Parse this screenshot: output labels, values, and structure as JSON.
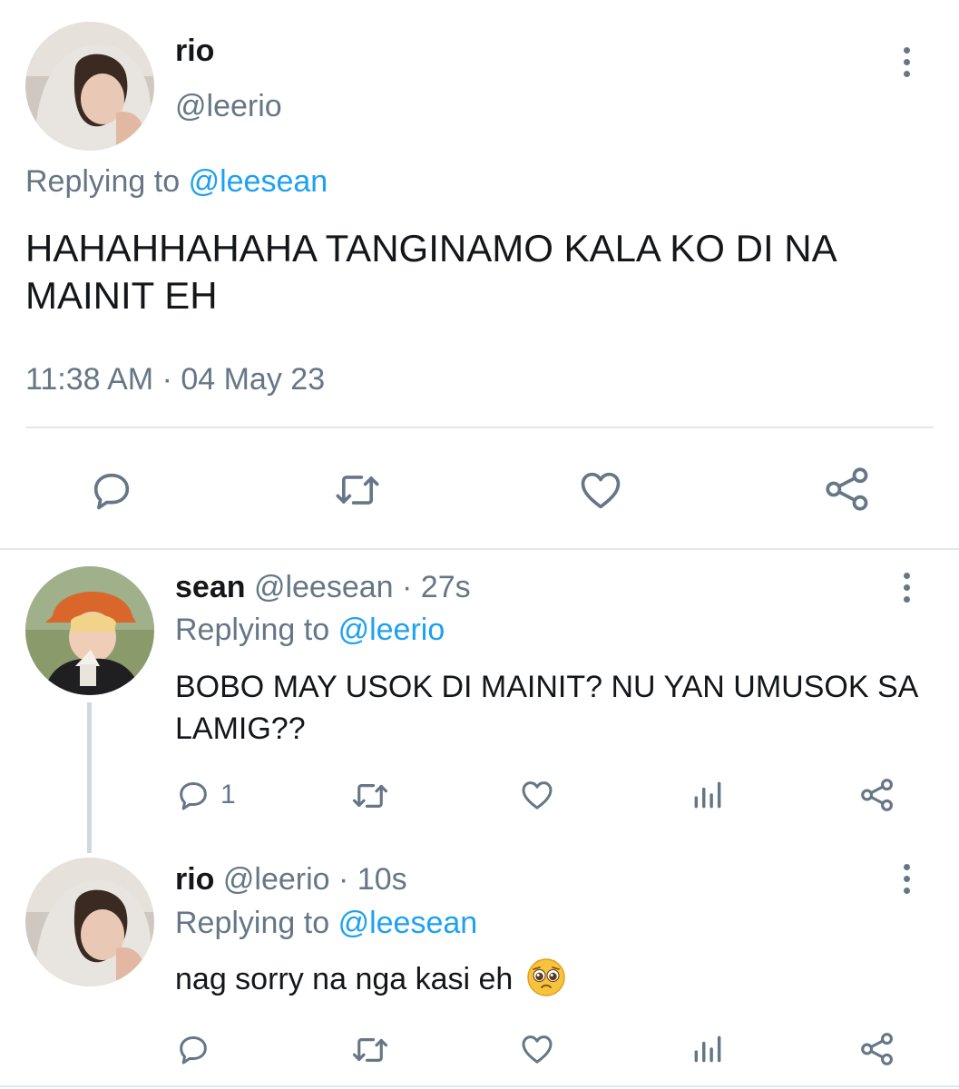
{
  "main_tweet": {
    "display_name": "rio",
    "handle": "@leerio",
    "replying_prefix": "Replying to",
    "replying_handle": "@leesean",
    "text": "HAHAHHAHAHA TANGINAMO KALA KO DI NA MAINIT EH",
    "timestamp": "11:38 AM · 04 May 23"
  },
  "replies": [
    {
      "display_name": "sean",
      "handle_time": "@leesean · 27s",
      "replying_prefix": "Replying to",
      "replying_handle": "@leerio",
      "text": "BOBO MAY USOK DI MAINIT? NU YAN UMUSOK SA LAMIG??",
      "reply_count": "1"
    },
    {
      "display_name": "rio",
      "handle_time": "@leerio · 10s",
      "replying_prefix": "Replying to",
      "replying_handle": "@leesean",
      "text": "nag sorry na nga kasi eh",
      "emoji": "🥺",
      "reply_count": ""
    }
  ],
  "colors": {
    "accent": "#1da1f2",
    "muted": "#657786",
    "text": "#14171a",
    "divider": "#e1e8ed"
  },
  "icons": [
    "more-vertical-icon",
    "reply-icon",
    "retweet-icon",
    "like-icon",
    "share-icon",
    "analytics-icon"
  ]
}
